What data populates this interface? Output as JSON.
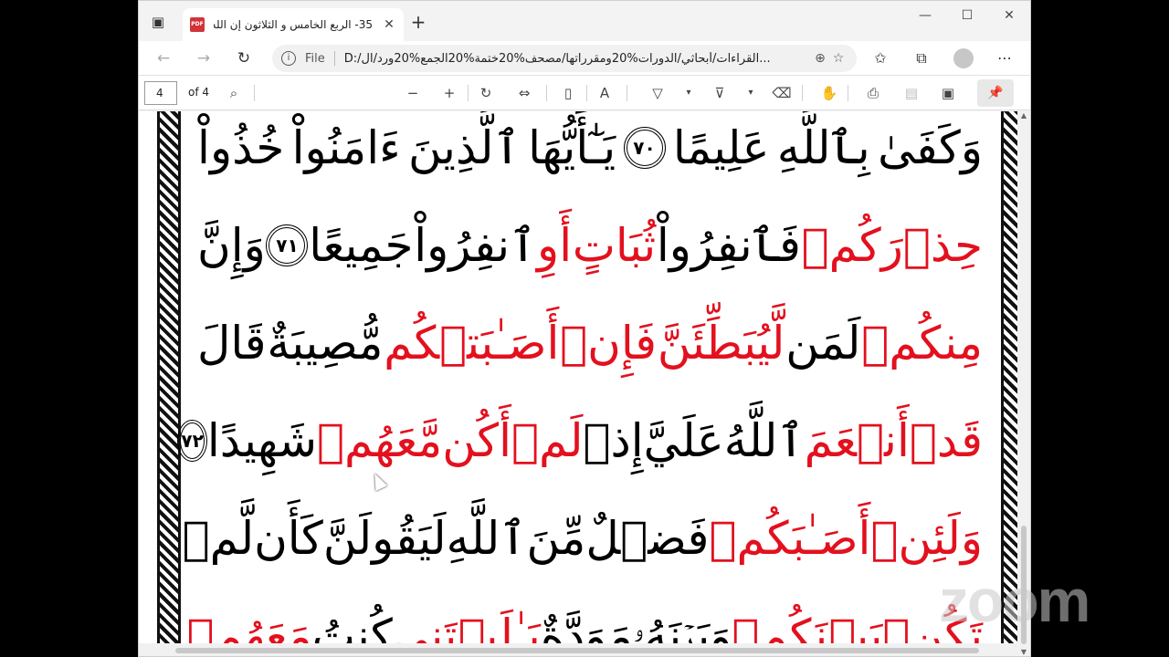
{
  "browser": {
    "tab_title": "35- الربع الخامس و الثلاثون إن الله",
    "tab_icon_label": "PDF",
    "window_controls": [
      "—",
      "☐",
      "✕"
    ]
  },
  "address": {
    "scheme_label": "File",
    "url": "D:/القراءات/أبحاثي/الدورات%20ومقرراتها/مصحف%20ختمة%20الجمع%20ورد/ال..."
  },
  "pdf": {
    "current_page": "4",
    "page_total": "of 4"
  },
  "quran_lines": [
    {
      "words": [
        {
          "t": "وَكَفَىٰ",
          "red": false
        },
        {
          "t": "بِٱللَّهِ",
          "red": false
        },
        {
          "t": "عَلِيمًا",
          "red": false
        },
        {
          "ayah": "٧٠"
        },
        {
          "t": "يَـٰٓأَيُّهَا",
          "red": false
        },
        {
          "t": "ٱلَّذِينَ",
          "red": false
        },
        {
          "t": "ءَامَنُواْ",
          "red": false
        },
        {
          "t": "خُذُواْ",
          "red": false
        }
      ]
    },
    {
      "words": [
        {
          "t": "حِذۡرَكُمۡ",
          "red": true
        },
        {
          "t": "فَٱنفِرُواْ",
          "red": false
        },
        {
          "t": "ثُبَاتٍ",
          "red": true
        },
        {
          "t": "أَوِ",
          "red": true
        },
        {
          "t": "ٱنفِرُواْ",
          "red": false
        },
        {
          "t": "جَمِيعًا",
          "red": false
        },
        {
          "ayah": "٧١"
        },
        {
          "t": "وَإِنَّ",
          "red": false
        }
      ]
    },
    {
      "words": [
        {
          "t": "مِنكُمۡ",
          "red": true
        },
        {
          "t": "لَمَن",
          "red": false
        },
        {
          "t": "لَّيُبَطِّئَنَّ",
          "red": true
        },
        {
          "t": "فَإِنۡ",
          "red": true
        },
        {
          "t": "أَصَـٰبَتۡكُم",
          "red": true
        },
        {
          "t": "مُّصِيبَةٌ",
          "red": false
        },
        {
          "t": "قَالَ",
          "red": false
        }
      ]
    },
    {
      "words": [
        {
          "t": "قَدۡ",
          "red": true
        },
        {
          "t": "أَنۡعَمَ",
          "red": true
        },
        {
          "t": "ٱللَّهُ",
          "red": false
        },
        {
          "t": "عَلَيَّ",
          "red": false
        },
        {
          "t": "إِذۡ",
          "red": false
        },
        {
          "t": "لَمۡ",
          "red": true
        },
        {
          "t": "أَكُن",
          "red": true
        },
        {
          "t": "مَّعَهُمۡ",
          "red": true
        },
        {
          "t": "شَهِيدًا",
          "red": false
        },
        {
          "ayah": "٧٢"
        }
      ]
    },
    {
      "words": [
        {
          "t": "وَلَئِنۡ",
          "red": true
        },
        {
          "t": "أَصَـٰبَكُمۡ",
          "red": true
        },
        {
          "t": "فَضۡلٌ",
          "red": false
        },
        {
          "t": "مِّنَ",
          "red": false
        },
        {
          "t": "ٱللَّهِ",
          "red": false
        },
        {
          "t": "لَيَقُولَنَّ",
          "red": false
        },
        {
          "t": "كَأَن",
          "red": false
        },
        {
          "t": "لَّمۡ",
          "red": false
        }
      ]
    },
    {
      "words": [
        {
          "t": "تَكُنۢ",
          "red": true
        },
        {
          "t": "بَيۡنَكُمۡ",
          "red": true
        },
        {
          "t": "وَبَيۡنَهُۥ",
          "red": false
        },
        {
          "t": "مَوَدَّةٌ",
          "red": false
        },
        {
          "t": "يَـٰلَيۡتَنِي",
          "red": true
        },
        {
          "t": "كُنتُ",
          "red": false
        },
        {
          "t": "مَعَهُمۡ",
          "red": true
        }
      ]
    }
  ],
  "watermark": "zoom",
  "icons": {
    "tab_actions": "tab-actions-icon",
    "new_tab": "plus-icon",
    "back": "arrow-left-icon",
    "forward": "arrow-right-icon",
    "refresh": "refresh-icon",
    "info": "info-icon",
    "zoom": "zoom-icon",
    "add_favorite": "star-add-icon",
    "favorites": "favorites-icon",
    "collections": "collections-icon",
    "profile": "profile-icon",
    "more": "more-icon"
  }
}
